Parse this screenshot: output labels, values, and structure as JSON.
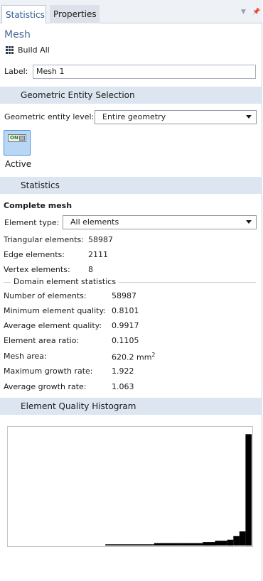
{
  "tabs": [
    {
      "label": "Statistics",
      "active": true
    },
    {
      "label": "Properties",
      "active": false
    }
  ],
  "mesh": {
    "title": "Mesh",
    "build_all": "Build All",
    "label_caption": "Label:",
    "label_value": "Mesh 1"
  },
  "geometric": {
    "section_title": "Geometric Entity Selection",
    "level_label": "Geometric entity level:",
    "level_value": "Entire geometry",
    "toggle_text": "ON",
    "active_label": "Active"
  },
  "statistics": {
    "section_title": "Statistics",
    "complete_mesh": "Complete mesh",
    "element_type_label": "Element type:",
    "element_type_value": "All elements",
    "counts": [
      {
        "label": "Triangular elements:",
        "value": "58987"
      },
      {
        "label": "Edge elements:",
        "value": "2111"
      },
      {
        "label": "Vertex elements:",
        "value": "8"
      }
    ],
    "domain_heading": "Domain element statistics",
    "domain": [
      {
        "label": "Number of elements:",
        "value": "58987"
      },
      {
        "label": "Minimum element quality:",
        "value": "0.8101"
      },
      {
        "label": "Average element quality:",
        "value": "0.9917"
      },
      {
        "label": "Element area ratio:",
        "value": "0.1105"
      },
      {
        "label": "Mesh area:",
        "value": "620.2 mm",
        "sup": "2"
      },
      {
        "label": "Maximum growth rate:",
        "value": "1.922"
      },
      {
        "label": "Average growth rate:",
        "value": "1.063"
      }
    ]
  },
  "histogram": {
    "section_title": "Element Quality Histogram"
  },
  "chart_data": {
    "type": "bar",
    "x": [
      0.8,
      0.82,
      0.84,
      0.86,
      0.88,
      0.9,
      0.92,
      0.94,
      0.96,
      0.97,
      0.98,
      0.985,
      0.99,
      0.995,
      1.0
    ],
    "values": [
      0,
      0,
      0,
      0,
      0,
      1,
      1,
      2,
      2,
      3,
      4,
      5,
      8,
      12,
      95
    ],
    "ylim": [
      0,
      100
    ]
  }
}
